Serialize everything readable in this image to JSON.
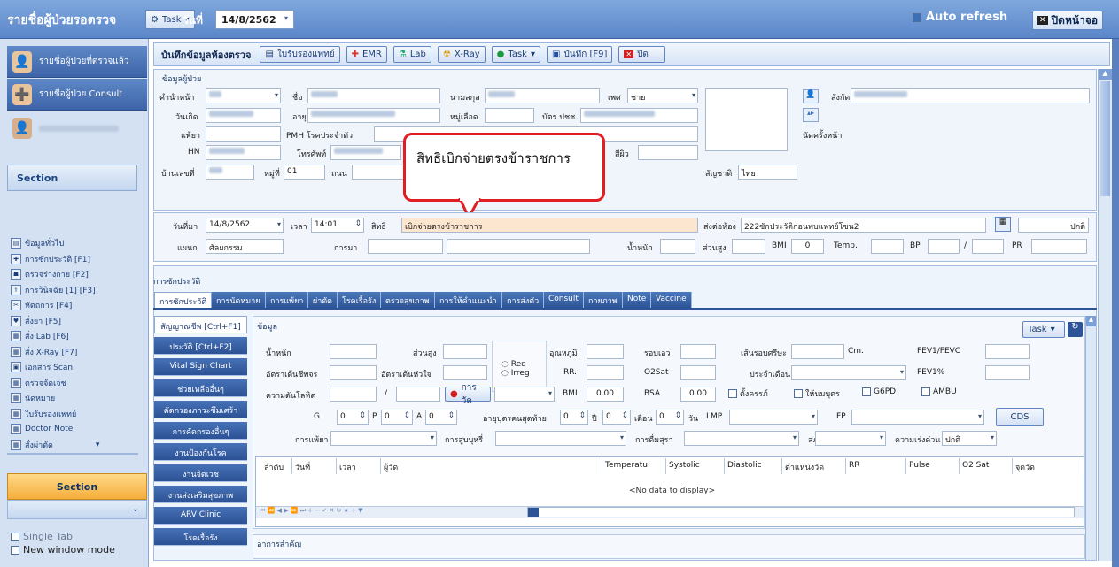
{
  "window": {
    "title": "รายชื่อผู้ป่วยรอตรวจ",
    "task_label": "Task",
    "date_label": "วันที่",
    "date_value": "14/8/2562",
    "auto_refresh": "Auto refresh",
    "close_screen": "ปิดหน้าจอ"
  },
  "left": {
    "btn_examined": "รายชื่อผู้ป่วยที่ตรวจแล้ว",
    "btn_consult": "รายชื่อผู้ป่วย Consult",
    "section_top": "Section",
    "items": [
      "ข้อมูลทั่วไป",
      "การซักประวัติ [F1]",
      "ตรวจร่างกาย [F2]",
      "การวินิจฉัย [1] [F3]",
      "หัตถการ [F4]",
      "สั่งยา [F5]",
      "สั่ง Lab [F6]",
      "สั่ง X-Ray [F7]",
      "เอกสาร Scan",
      "ตรวจจัดเจช",
      "นัดหมาย",
      "ใบรับรองแพทย์",
      "Doctor Note",
      "สั่งผ่าตัด"
    ],
    "section_bottom": "Section",
    "single_tab": "Single Tab",
    "new_window": "New window mode"
  },
  "toolbar": {
    "title": "บันทึกข้อมูลห้องตรวจ",
    "cert": "ใบรับรองแพทย์",
    "emr": "EMR",
    "lab": "Lab",
    "xray": "X-Ray",
    "task": "Task",
    "save": "บันทึก [F9]",
    "close": "ปิด"
  },
  "patient": {
    "group": "ข้อมูลผู้ป่วย",
    "prefix_label": "คำนำหน้า",
    "name_label": "ชื่อ",
    "surname_label": "นามสกุล",
    "sex_label": "เพศ",
    "sex_value": "ชาย",
    "affil_label": "สังกัด",
    "birth_label": "วันเกิด",
    "age_label": "อายุ",
    "blood_label": "หมู่เลือด",
    "id_label": "บัตร ปชช.",
    "allergy_label": "แพ้ยา",
    "pmh_label": "PMH โรคประจำตัว",
    "next_appt_label": "นัดครั้งหน้า",
    "hn_label": "HN",
    "phone_label": "โทรศัพท์",
    "skin_label": "สีผิว",
    "house_label": "บ้านเลขที่",
    "moo_label": "หมู่ที่",
    "moo_value": "01",
    "road_label": "ถนน",
    "nation_label": "สัญชาติ",
    "nation_value": "ไทย"
  },
  "visit": {
    "date_label": "วันที่มา",
    "date_value": "14/8/2562",
    "time_label": "เวลา",
    "time_value": "14:01",
    "right_label": "สิทธิ",
    "right_value": "เบิกจ่ายตรงข้าราชการ",
    "send_label": "ส่งต่อห้อง",
    "send_value": "222ซักประวัติก่อนพบแพทย์โซน2",
    "status_value": "ปกติ",
    "dept_label": "แผนก",
    "dept_value": "ศัลยกรรม",
    "cc_label": "การมา",
    "weight_label": "น้ำหนัก",
    "height_label": "ส่วนสูง",
    "bmi_label": "BMI",
    "bmi_value": "0",
    "temp_label": "Temp.",
    "bp_label": "BP",
    "pr_label": "PR"
  },
  "callout": "สิทธิเบิกจ่ายตรงข้าราชการ",
  "history": {
    "group": "การซักประวัติ",
    "tabs": [
      "การซักประวัติ",
      "การนัดหมาย",
      "การแพ้ยา",
      "ผ่าตัด",
      "โรคเรื้อรัง",
      "ตรวจสุขภาพ",
      "การให้คำแนะนำ",
      "การส่งตัว",
      "Consult",
      "กายภาพ",
      "Note",
      "Vaccine"
    ],
    "vtabs": [
      "สัญญาณชีพ [Ctrl+F1]",
      "ประวัติ [Ctrl+F2]",
      "Vital Sign Chart",
      "ช่วยเหลืออื่นๆ",
      "คัดกรองภาวะซึมเศร้า",
      "การคัดกรองอื่นๆ",
      "งานป้องกันโรค",
      "งานจิตเวช",
      "งานส่งเสริมสุขภาพ",
      "ARV Clinic",
      "โรคเรื้อรัง"
    ],
    "info_label": "ข้อมูล",
    "task_label": "Task",
    "f_weight": "น้ำหนัก",
    "f_height": "ส่วนสูง",
    "f_temp": "อุณหภูมิ",
    "f_waist": "รอบเอว",
    "f_head": "เส้นรอบศรีษะ",
    "f_cm": "Cm.",
    "f_fev": "FEV1/FEVC",
    "f_pulse": "อัตราเต้นชีพจร",
    "f_heart": "อัตราเต้นหัวใจ",
    "f_req": "Req",
    "f_irreq": "Irreg",
    "f_rr": "RR.",
    "f_o2": "O2Sat",
    "f_month": "ประจำเดือน",
    "f_fevp": "FEV1%",
    "f_bp": "ความดันโลหิต",
    "f_measure": "การวัด",
    "f_bmi": "BMI",
    "f_bmi_v": "0.00",
    "f_bsa": "BSA",
    "f_bsa_v": "0.00",
    "f_preg": "ตั้งครรภ์",
    "f_breast": "ให้นมบุตร",
    "f_g6pd": "G6PD",
    "f_ambu": "AMBU",
    "f_g": "G",
    "f_p": "P",
    "f_a": "A",
    "f_zero": "0",
    "f_lastchild": "อายุบุตรคนสุดท้าย",
    "f_year": "ปี",
    "f_monthu": "เดือน",
    "f_day": "วัน",
    "f_lmp": "LMP",
    "f_fp": "FP",
    "f_cds": "CDS",
    "f_allergy": "การแพ้ยา",
    "f_smoke": "การสูบบุหรี่",
    "f_alcohol": "การดื่มสุรา",
    "f_cond": "สภาพ",
    "f_urg": "ความเร่งด่วน",
    "f_urg_v": "ปกติ",
    "grid_cols": [
      "ลำดับ",
      "วันที่",
      "เวลา",
      "ผู้วัด",
      "Temperatu",
      "Systolic",
      "Diastolic",
      "ตำแหน่งวัด",
      "RR",
      "Pulse",
      "O2 Sat",
      "จุดวัด"
    ],
    "no_data": "<No data to display>",
    "symptom_label": "อาการสำคัญ"
  },
  "colors": {
    "title_bar": "#5b86c9",
    "callout_border": "#e01e24",
    "tab_blue": "#2d5496"
  }
}
